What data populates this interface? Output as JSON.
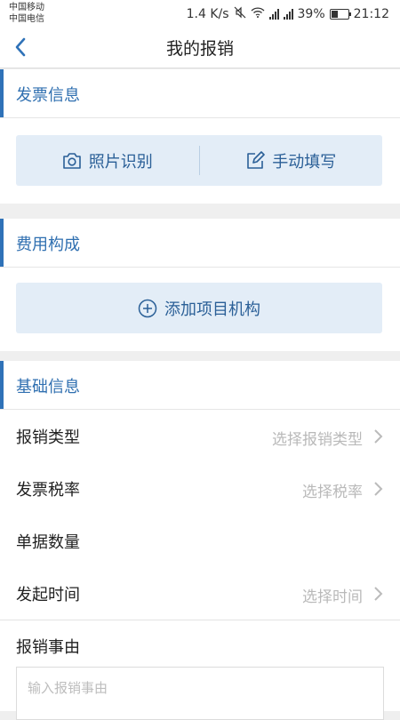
{
  "status": {
    "carrier1": "中国移动",
    "carrier2": "中国电信",
    "speed": "1.4 K/s",
    "battery": "39%",
    "time": "21:12"
  },
  "nav": {
    "title": "我的报销"
  },
  "invoice": {
    "title": "发票信息",
    "photo_label": "照片识别",
    "manual_label": "手动填写"
  },
  "cost": {
    "title": "费用构成",
    "add_label": "添加项目机构"
  },
  "basic": {
    "title": "基础信息",
    "rows": [
      {
        "label": "报销类型",
        "value": "选择报销类型"
      },
      {
        "label": "发票税率",
        "value": "选择税率"
      },
      {
        "label": "单据数量",
        "value": ""
      },
      {
        "label": "发起时间",
        "value": "选择时间"
      }
    ],
    "reason_label": "报销事由",
    "reason_placeholder": "输入报销事由"
  },
  "colors": {
    "accent": "#2f72b8",
    "button_bg": "#e3edf7",
    "background": "#efefef"
  }
}
